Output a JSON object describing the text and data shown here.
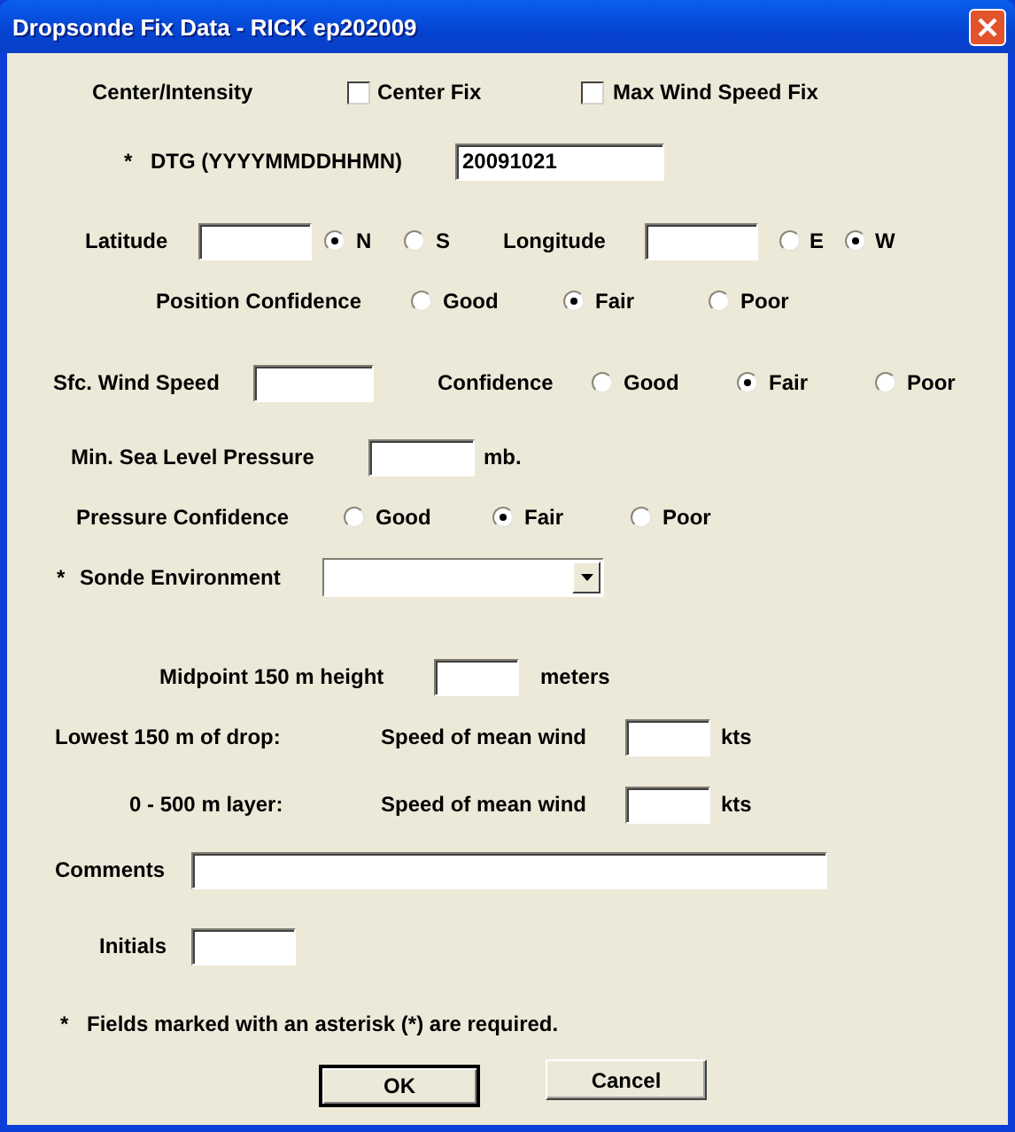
{
  "window": {
    "title": "Dropsonde Fix Data - RICK ep202009"
  },
  "center_intensity": {
    "label": "Center/Intensity",
    "options": [
      {
        "label": "Center Fix",
        "checked": false
      },
      {
        "label": "Max Wind Speed Fix",
        "checked": false
      }
    ]
  },
  "dtg": {
    "required_mark": "*",
    "label": "DTG (YYYYMMDDHHMN)",
    "value": "20091021"
  },
  "latitude": {
    "label": "Latitude",
    "hemispheres": [
      {
        "label": "N",
        "selected": true
      },
      {
        "label": "S",
        "selected": false
      }
    ]
  },
  "longitude": {
    "label": "Longitude",
    "hemispheres": [
      {
        "label": "E",
        "selected": false
      },
      {
        "label": "W",
        "selected": true
      }
    ]
  },
  "position_confidence": {
    "label": "Position Confidence",
    "options": [
      {
        "label": "Good",
        "selected": false
      },
      {
        "label": "Fair",
        "selected": true
      },
      {
        "label": "Poor",
        "selected": false
      }
    ]
  },
  "wind_speed": {
    "label": "Sfc. Wind Speed",
    "confidence_label": "Confidence",
    "options": [
      {
        "label": "Good",
        "selected": false
      },
      {
        "label": "Fair",
        "selected": true
      },
      {
        "label": "Poor",
        "selected": false
      }
    ]
  },
  "pressure": {
    "label": "Min. Sea Level Pressure",
    "unit": "mb."
  },
  "pressure_confidence": {
    "label": "Pressure Confidence",
    "options": [
      {
        "label": "Good",
        "selected": false
      },
      {
        "label": "Fair",
        "selected": true
      },
      {
        "label": "Poor",
        "selected": false
      }
    ]
  },
  "sonde_environment": {
    "required_mark": "*",
    "label": "Sonde Environment"
  },
  "midpoint": {
    "label": "Midpoint 150 m height",
    "unit": "meters"
  },
  "winds": [
    {
      "label": "Lowest 150 m of drop:",
      "field_label": "Speed of mean wind",
      "unit": "kts"
    },
    {
      "label": "0 - 500 m layer:",
      "field_label": "Speed of mean wind",
      "unit": "kts"
    }
  ],
  "comments": {
    "label": "Comments"
  },
  "initials": {
    "label": "Initials"
  },
  "footnote": {
    "mark": "*",
    "text": "Fields marked with an asterisk (*) are required."
  },
  "buttons": [
    {
      "label": "OK",
      "default": true
    },
    {
      "label": "Cancel",
      "default": false
    }
  ]
}
